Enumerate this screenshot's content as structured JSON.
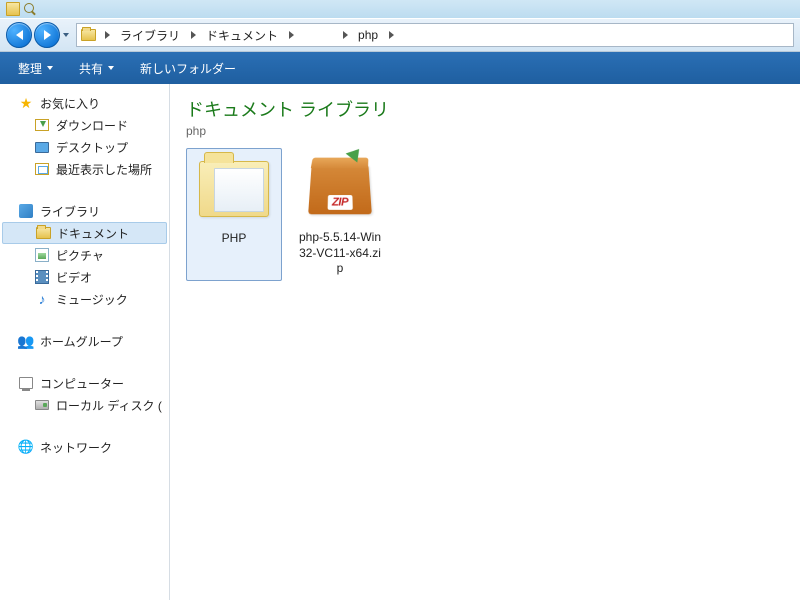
{
  "breadcrumb": {
    "items": [
      "ライブラリ",
      "ドキュメント",
      "",
      "php"
    ]
  },
  "toolbar": {
    "organize": "整理",
    "share": "共有",
    "new_folder": "新しいフォルダー"
  },
  "sidebar": {
    "favorites": {
      "label": "お気に入り",
      "items": [
        {
          "icon": "download",
          "label": "ダウンロード"
        },
        {
          "icon": "desktop",
          "label": "デスクトップ"
        },
        {
          "icon": "recent",
          "label": "最近表示した場所"
        }
      ]
    },
    "libraries": {
      "label": "ライブラリ",
      "items": [
        {
          "icon": "folder",
          "label": "ドキュメント",
          "selected": true
        },
        {
          "icon": "picture",
          "label": "ピクチャ"
        },
        {
          "icon": "video",
          "label": "ビデオ"
        },
        {
          "icon": "music",
          "label": "ミュージック"
        }
      ]
    },
    "homegroup": {
      "label": "ホームグループ"
    },
    "computer": {
      "label": "コンピューター",
      "items": [
        {
          "icon": "disk",
          "label": "ローカル ディスク ("
        }
      ]
    },
    "network": {
      "label": "ネットワーク"
    }
  },
  "content": {
    "title": "ドキュメント ライブラリ",
    "subtitle": "php",
    "items": [
      {
        "type": "folder",
        "name": "PHP",
        "selected": true
      },
      {
        "type": "zip",
        "name": "php-5.5.14-Win32-VC11-x64.zip",
        "badge": "ZIP"
      }
    ]
  }
}
